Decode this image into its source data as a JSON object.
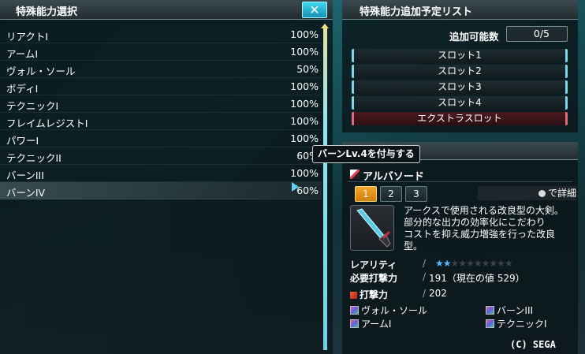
{
  "left_panel": {
    "title": "特殊能力選択",
    "close_label": "✕",
    "items": [
      {
        "name": "リアクトI",
        "percent": "100%"
      },
      {
        "name": "アームI",
        "percent": "100%"
      },
      {
        "name": "ヴォル・ソール",
        "percent": "50%"
      },
      {
        "name": "ボディI",
        "percent": "100%"
      },
      {
        "name": "テクニックI",
        "percent": "100%"
      },
      {
        "name": "フレイムレジストI",
        "percent": "100%"
      },
      {
        "name": "パワーI",
        "percent": "100%"
      },
      {
        "name": "テクニックII",
        "percent": "60%"
      },
      {
        "name": "バーンIII",
        "percent": "100%"
      },
      {
        "name": "バーンIV",
        "percent": "60%"
      }
    ]
  },
  "tooltip": "バーンLv.4を付与する",
  "add_list_panel": {
    "title": "特殊能力追加予定リスト",
    "count_label": "追加可能数",
    "count_value": "0/5",
    "slots": [
      "スロット1",
      "スロット2",
      "スロット3",
      "スロット4"
    ],
    "extra_slot": "エクストラスロット"
  },
  "weapon_panel": {
    "name": "アルバソード",
    "tabs": [
      "1",
      "2",
      "3"
    ],
    "detail_hint": "で詳細",
    "description": [
      "アークスで使用される改良型の大剣。",
      "部分的な出力の効率化にこだわり",
      "コストを抑え威力増強を行った改良型。"
    ],
    "rarity_label": "レアリティ",
    "rarity": 2,
    "rarity_max": 10,
    "required_label": "必要打撃力",
    "required_value": "191（現在の値 529）",
    "attack_label": "打撃力",
    "attack_value": "202",
    "affixes": [
      "ヴォル・ソール",
      "バーンIII",
      "アームI",
      "テクニックI"
    ]
  },
  "copyright": "(C) SEGA",
  "colors": {
    "accent": "#3fd7f0",
    "active_tab": "#f2a52a",
    "extra_slot": "#4a1a20"
  }
}
